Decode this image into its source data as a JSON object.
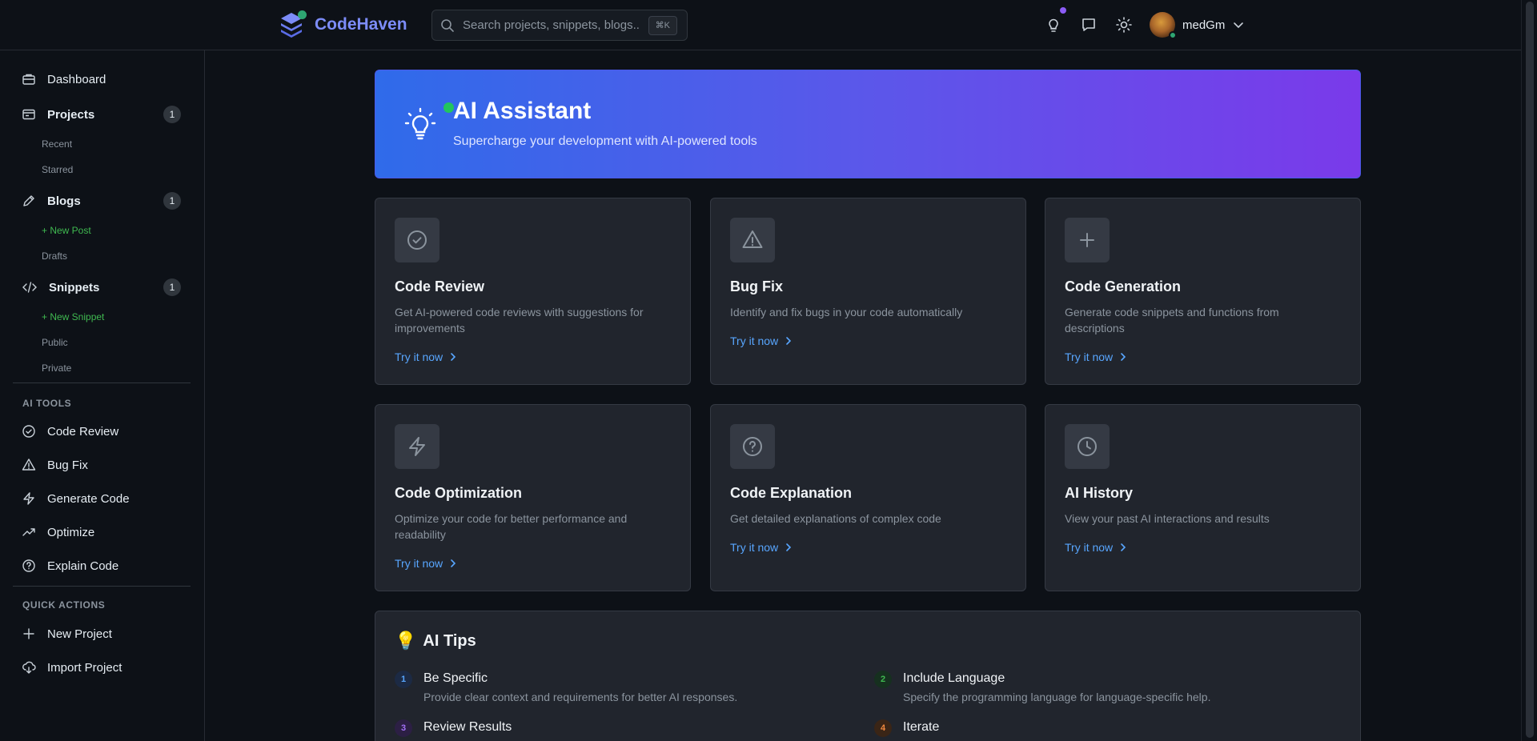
{
  "app": {
    "name": "CodeHaven",
    "search_placeholder": "Search projects, snippets, blogs...",
    "search_shortcut": "⌘K",
    "username": "medGm"
  },
  "sidebar": {
    "dashboard": "Dashboard",
    "projects": {
      "label": "Projects",
      "count": "1",
      "sub": [
        "Recent",
        "Starred"
      ]
    },
    "blogs": {
      "label": "Blogs",
      "count": "1",
      "sub": [
        "+ New Post",
        "Drafts"
      ]
    },
    "snippets": {
      "label": "Snippets",
      "count": "1",
      "sub": [
        "+ New Snippet",
        "Public",
        "Private"
      ]
    },
    "ai_tools_title": "AI TOOLS",
    "ai_tools": [
      "Code Review",
      "Bug Fix",
      "Generate Code",
      "Optimize",
      "Explain Code"
    ],
    "quick_actions_title": "QUICK ACTIONS",
    "quick_actions": [
      "New Project",
      "Import Project"
    ]
  },
  "hero": {
    "title": "AI Assistant",
    "subtitle": "Supercharge your development with AI-powered tools"
  },
  "cards": [
    {
      "title": "Code Review",
      "desc": "Get AI-powered code reviews with suggestions for improvements",
      "link": "Try it now",
      "icon": "check-circle-icon"
    },
    {
      "title": "Bug Fix",
      "desc": "Identify and fix bugs in your code automatically",
      "link": "Try it now",
      "icon": "warning-icon"
    },
    {
      "title": "Code Generation",
      "desc": "Generate code snippets and functions from descriptions",
      "link": "Try it now",
      "icon": "plus-icon"
    },
    {
      "title": "Code Optimization",
      "desc": "Optimize your code for better performance and readability",
      "link": "Try it now",
      "icon": "lightning-icon"
    },
    {
      "title": "Code Explanation",
      "desc": "Get detailed explanations of complex code",
      "link": "Try it now",
      "icon": "question-circle-icon"
    },
    {
      "title": "AI History",
      "desc": "View your past AI interactions and results",
      "link": "Try it now",
      "icon": "clock-icon"
    }
  ],
  "tips": {
    "emoji": "💡",
    "title": "AI Tips",
    "items": [
      {
        "num": "1",
        "title": "Be Specific",
        "desc": "Provide clear context and requirements for better AI responses."
      },
      {
        "num": "2",
        "title": "Include Language",
        "desc": "Specify the programming language for language-specific help."
      },
      {
        "num": "3",
        "title": "Review Results",
        "desc": ""
      },
      {
        "num": "4",
        "title": "Iterate",
        "desc": ""
      }
    ]
  },
  "colors": {
    "accent_blue": "#58a6ff",
    "accent_green": "#3fb950",
    "hero_start": "#2f6bea",
    "hero_end": "#7a3aea"
  }
}
